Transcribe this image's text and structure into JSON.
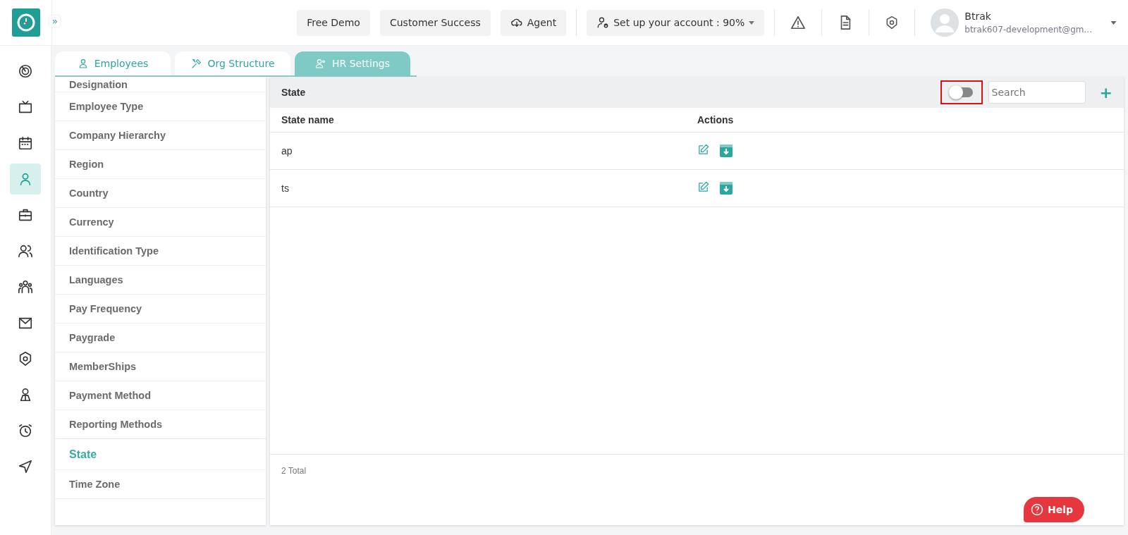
{
  "header": {
    "expand_icon": "»",
    "buttons": [
      {
        "label": "Free Demo",
        "kind": "plain"
      },
      {
        "label": "Customer Success",
        "kind": "plain"
      },
      {
        "label": "Agent",
        "kind": "cloud"
      },
      {
        "label": "Set up your account : 90%",
        "kind": "setup"
      }
    ],
    "user": {
      "name": "Btrak",
      "email": "btrak607-development@gm..."
    }
  },
  "nav": [
    {
      "selected": false
    },
    {
      "selected": false
    },
    {
      "selected": false
    },
    {
      "selected": true
    },
    {
      "selected": false
    },
    {
      "selected": false
    },
    {
      "selected": false
    },
    {
      "selected": false
    },
    {
      "selected": false
    },
    {
      "selected": false
    },
    {
      "selected": false
    },
    {
      "selected": false
    }
  ],
  "tabs": [
    {
      "label": "Employees",
      "selected": false
    },
    {
      "label": "Org Structure",
      "selected": false
    },
    {
      "label": "HR Settings",
      "selected": true
    }
  ],
  "settings": [
    {
      "label": "Designation",
      "selected": false
    },
    {
      "label": "Employee Type",
      "selected": false
    },
    {
      "label": "Company Hierarchy",
      "selected": false
    },
    {
      "label": "Region",
      "selected": false
    },
    {
      "label": "Country",
      "selected": false
    },
    {
      "label": "Currency",
      "selected": false
    },
    {
      "label": "Identification Type",
      "selected": false
    },
    {
      "label": "Languages",
      "selected": false
    },
    {
      "label": "Pay Frequency",
      "selected": false
    },
    {
      "label": "Paygrade",
      "selected": false
    },
    {
      "label": "MemberShips",
      "selected": false
    },
    {
      "label": "Payment Method",
      "selected": false
    },
    {
      "label": "Reporting Methods",
      "selected": false
    },
    {
      "label": "State",
      "selected": true
    },
    {
      "label": "Time Zone",
      "selected": false
    }
  ],
  "panel": {
    "title": "State",
    "archive_toggle": {
      "on": false,
      "annotation": {
        "kind": "red-frame"
      }
    },
    "search": {
      "placeholder": "Search"
    },
    "add_icon": "+",
    "table": {
      "columns": [
        "State name",
        "Actions"
      ],
      "rows": [
        {
          "name": "ap"
        },
        {
          "name": "ts"
        }
      ]
    },
    "total": "2 Total"
  },
  "help": {
    "label": "Help"
  }
}
